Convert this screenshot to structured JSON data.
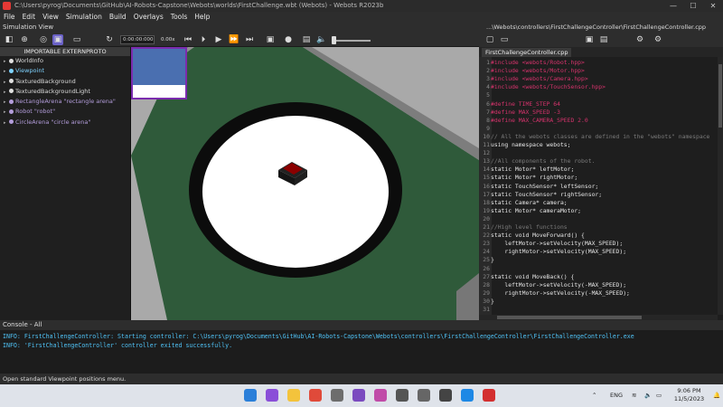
{
  "window": {
    "title": "C:\\Users\\pyrog\\Documents\\GitHub\\AI-Robots-Capstone\\Webots\\worlds\\FirstChallenge.wbt (Webots) - Webots R2023b",
    "controls": [
      "—",
      "☐",
      "✕"
    ]
  },
  "menu": [
    "File",
    "Edit",
    "View",
    "Simulation",
    "Build",
    "Overlays",
    "Tools",
    "Help"
  ],
  "simulation_view": {
    "label": "Simulation View",
    "time": "0:00:00:000",
    "speed": "0.00x"
  },
  "scene_tree": {
    "header": "IMPORTABLE EXTERNPROTO",
    "items": [
      {
        "label": "WorldInfo",
        "color": "#e0e0e0"
      },
      {
        "label": "Viewpoint",
        "color": "#7fd3ff"
      },
      {
        "label": "TexturedBackground",
        "color": "#e0e0e0"
      },
      {
        "label": "TexturedBackgroundLight",
        "color": "#e0e0e0"
      },
      {
        "label": "RectangleArena \"rectangle arena\"",
        "color": "#b39ddb"
      },
      {
        "label": "Robot \"robot\"",
        "color": "#b39ddb"
      },
      {
        "label": "CircleArena \"circle arena\"",
        "color": "#b39ddb"
      }
    ]
  },
  "editor": {
    "path": "...\\Webots\\controllers\\FirstChallengeController\\FirstChallengeController.cpp",
    "tab": "FirstChallengeController.cpp",
    "lines": [
      {
        "n": "1",
        "t": "#include <webots/Robot.hpp>",
        "c": "pp"
      },
      {
        "n": "2",
        "t": "#include <webots/Motor.hpp>",
        "c": "pp"
      },
      {
        "n": "3",
        "t": "#include <webots/Camera.hpp>",
        "c": "pp"
      },
      {
        "n": "4",
        "t": "#include <webots/TouchSensor.hpp>",
        "c": "pp"
      },
      {
        "n": "5",
        "t": "",
        "c": "tx"
      },
      {
        "n": "6",
        "t": "#define TIME_STEP 64",
        "c": "pp"
      },
      {
        "n": "7",
        "t": "#define MAX_SPEED -3",
        "c": "pp"
      },
      {
        "n": "8",
        "t": "#define MAX_CAMERA_SPEED 2.0",
        "c": "pp"
      },
      {
        "n": "9",
        "t": "",
        "c": "tx"
      },
      {
        "n": "10",
        "t": "// All the webots classes are defined in the \"webots\" namespace",
        "c": "cm"
      },
      {
        "n": "11",
        "t": "using namespace webots;",
        "c": "tx"
      },
      {
        "n": "12",
        "t": "",
        "c": "tx"
      },
      {
        "n": "13",
        "t": "//All components of the robot.",
        "c": "cm"
      },
      {
        "n": "14",
        "t": "static Motor* leftMotor;",
        "c": "tx"
      },
      {
        "n": "15",
        "t": "static Motor* rightMotor;",
        "c": "tx"
      },
      {
        "n": "16",
        "t": "static TouchSensor* leftSensor;",
        "c": "tx"
      },
      {
        "n": "17",
        "t": "static TouchSensor* rightSensor;",
        "c": "tx"
      },
      {
        "n": "18",
        "t": "static Camera* camera;",
        "c": "tx"
      },
      {
        "n": "19",
        "t": "static Motor* cameraMotor;",
        "c": "tx"
      },
      {
        "n": "20",
        "t": "",
        "c": "tx"
      },
      {
        "n": "21",
        "t": "//High level functions",
        "c": "cm"
      },
      {
        "n": "22",
        "t": "static void MoveForward() {",
        "c": "tx"
      },
      {
        "n": "23",
        "t": "    leftMotor->setVelocity(MAX_SPEED);",
        "c": "tx"
      },
      {
        "n": "24",
        "t": "    rightMotor->setVelocity(MAX_SPEED);",
        "c": "tx"
      },
      {
        "n": "25",
        "t": "}",
        "c": "tx"
      },
      {
        "n": "26",
        "t": "",
        "c": "tx"
      },
      {
        "n": "27",
        "t": "static void MoveBack() {",
        "c": "tx"
      },
      {
        "n": "28",
        "t": "    leftMotor->setVelocity(-MAX_SPEED);",
        "c": "tx"
      },
      {
        "n": "29",
        "t": "    rightMotor->setVelocity(-MAX_SPEED);",
        "c": "tx"
      },
      {
        "n": "30",
        "t": "}",
        "c": "tx"
      },
      {
        "n": "31",
        "t": "",
        "c": "tx"
      }
    ]
  },
  "console": {
    "label": "Console - All",
    "lines": [
      "INFO: FirstChallengeController: Starting controller: C:\\Users\\pyrog\\Documents\\GitHub\\AI-Robots-Capstone\\Webots\\controllers\\FirstChallengeController\\FirstChallengeController.exe",
      "INFO: 'FirstChallengeController' controller exited successfully."
    ]
  },
  "status": "Open standard Viewpoint positions menu.",
  "taskbar": {
    "apps": [
      {
        "name": "windows-start-icon",
        "color": "#2b7fd9"
      },
      {
        "name": "visual-studio-icon",
        "color": "#8a4fd8"
      },
      {
        "name": "file-explorer-icon",
        "color": "#f3c33c"
      },
      {
        "name": "chrome-icon",
        "color": "#e04a3a"
      },
      {
        "name": "calculator-icon",
        "color": "#6d6d6d"
      },
      {
        "name": "github-desktop-icon",
        "color": "#7b4bbf"
      },
      {
        "name": "app-icon",
        "color": "#c04ba8"
      },
      {
        "name": "app-icon",
        "color": "#555555"
      },
      {
        "name": "app-icon",
        "color": "#666666"
      },
      {
        "name": "app-icon",
        "color": "#444444"
      },
      {
        "name": "vscode-icon",
        "color": "#1e88e5"
      },
      {
        "name": "webots-icon",
        "color": "#d32f2f"
      }
    ],
    "lang": "ENG",
    "time": "9:06 PM",
    "date": "11/5/2023"
  }
}
